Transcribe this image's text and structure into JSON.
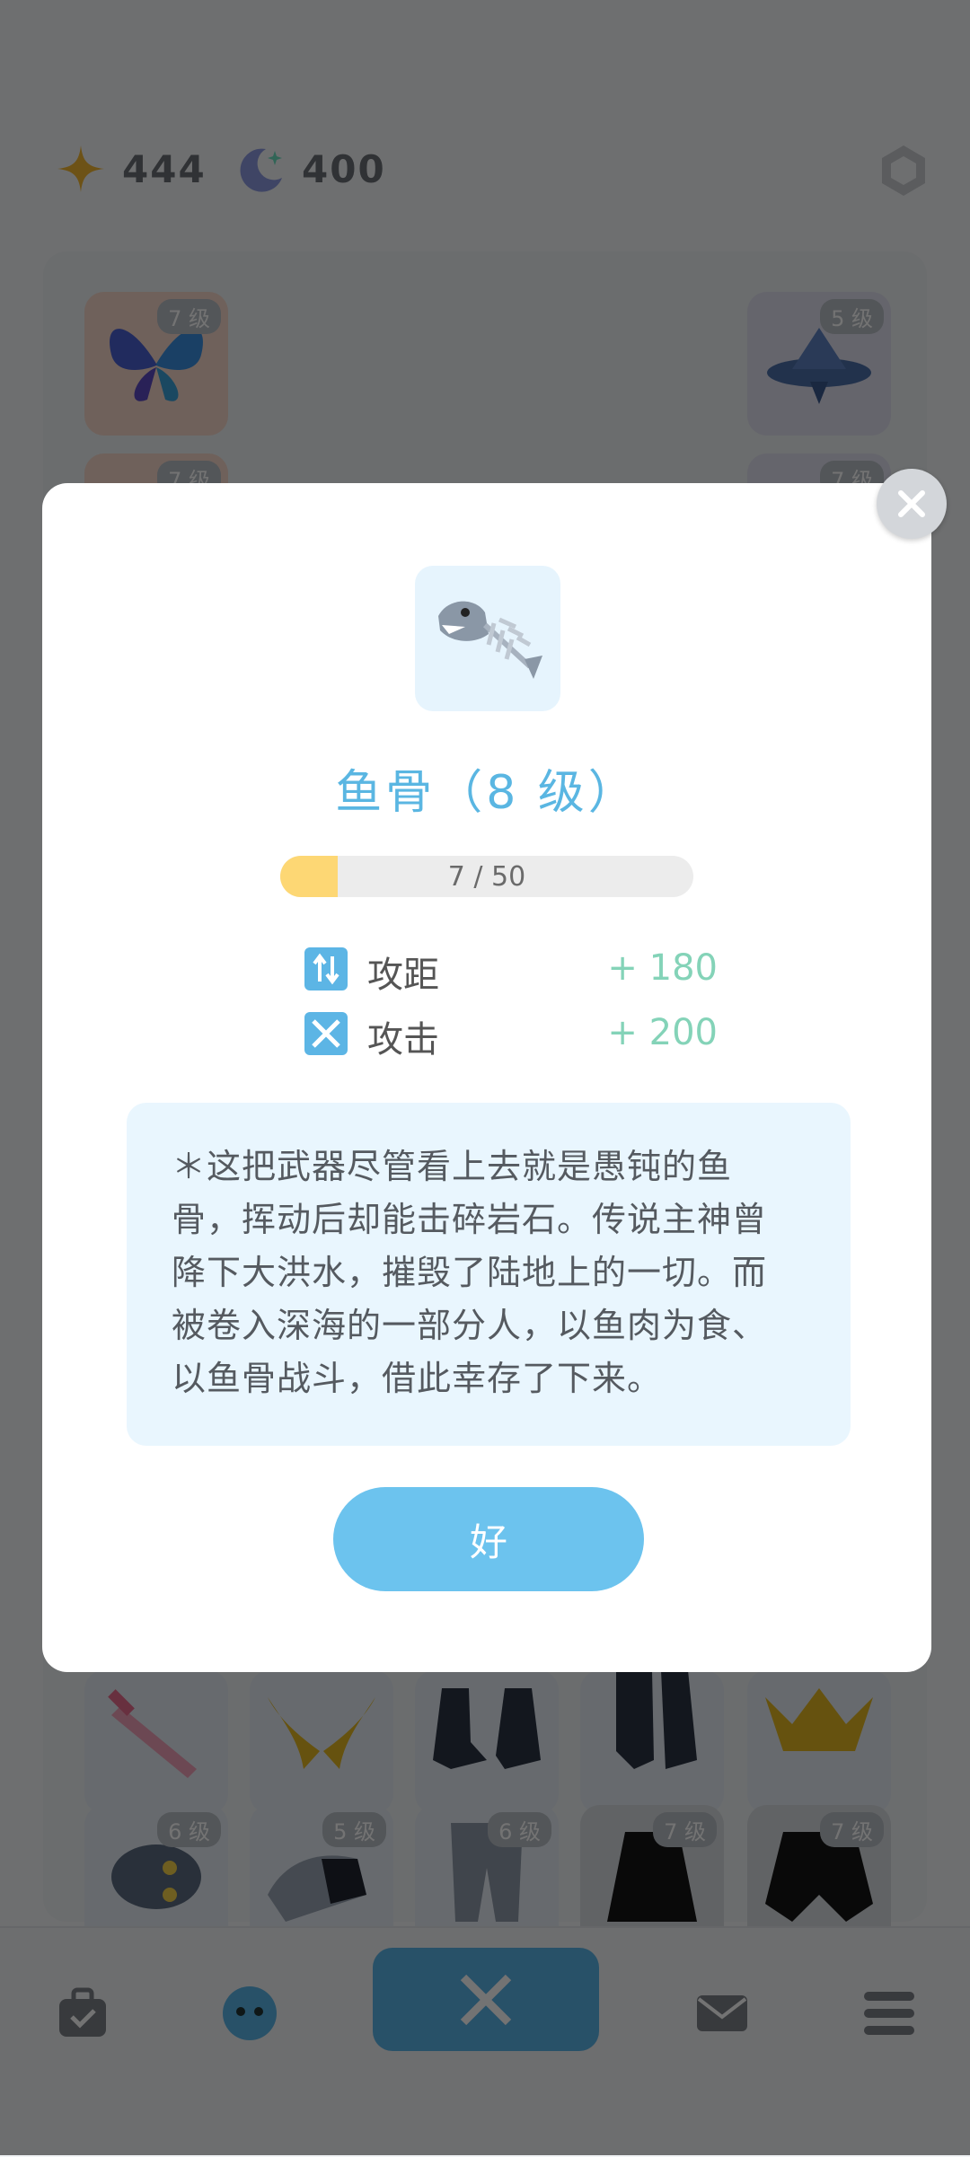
{
  "currency": {
    "star_value": "444",
    "moon_value": "400"
  },
  "slots": {
    "top_left_level": "7 级",
    "top_left2_level": "7 级",
    "top_right_level": "5 级",
    "top_right2_level": "7 级",
    "row_b": [
      "6 级",
      "5 级",
      "6 级",
      "7 级",
      "7 级"
    ]
  },
  "modal": {
    "item_title": "鱼骨（8 级）",
    "progress": {
      "current": 7,
      "max": 50,
      "text": "7 / 50"
    },
    "stats": [
      {
        "label": "攻距",
        "value": "+ 180",
        "icon": "range-arrows-icon"
      },
      {
        "label": "攻击",
        "value": "+ 200",
        "icon": "crossed-swords-icon"
      }
    ],
    "description_lines": [
      "＊这把武器尽管看上去就是愚钝的鱼",
      "骨，挥动后却能击碎岩石。传说主神曾",
      "降下大洪水，摧毁了陆地上的一切。而",
      "被卷入深海的一部分人，以鱼肉为食、",
      "以鱼骨战斗，借此幸存了下来。"
    ],
    "ok_label": "好"
  },
  "colors": {
    "accent": "#5ab6e2",
    "progress_fill": "#fdd774",
    "stat_value": "#84d3b8",
    "desc_bg": "#e9f6fe"
  }
}
